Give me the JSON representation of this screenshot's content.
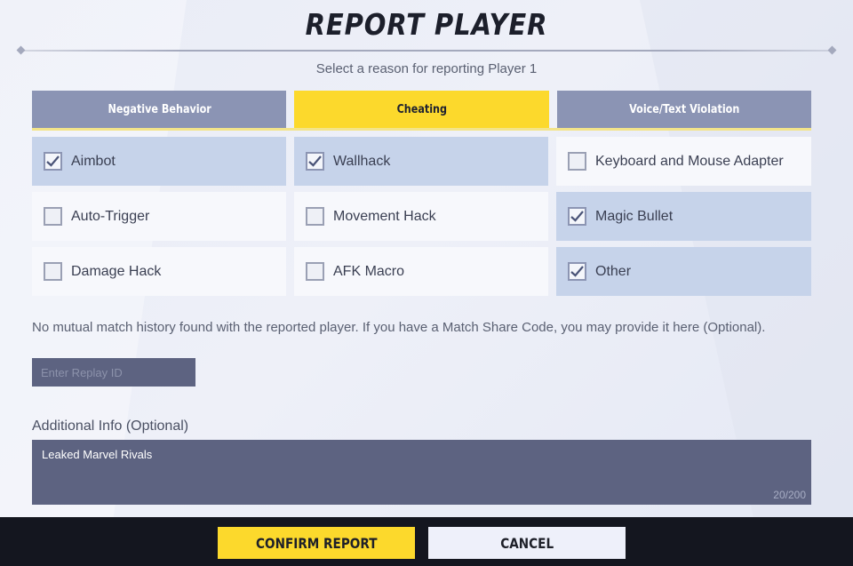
{
  "dialog": {
    "title": "REPORT PLAYER",
    "subtitle": "Select a reason for reporting Player 1"
  },
  "tabs": [
    {
      "label": "Negative Behavior",
      "active": false
    },
    {
      "label": "Cheating",
      "active": true
    },
    {
      "label": "Voice/Text Violation",
      "active": false
    }
  ],
  "options": [
    {
      "label": "Aimbot",
      "checked": true
    },
    {
      "label": "Wallhack",
      "checked": true
    },
    {
      "label": "Keyboard and Mouse Adapter",
      "checked": false
    },
    {
      "label": "Auto-Trigger",
      "checked": false
    },
    {
      "label": "Movement Hack",
      "checked": false
    },
    {
      "label": "Magic Bullet",
      "checked": true
    },
    {
      "label": "Damage Hack",
      "checked": false
    },
    {
      "label": "AFK Macro",
      "checked": false
    },
    {
      "label": "Other",
      "checked": true
    }
  ],
  "match": {
    "notice": "No mutual match history found with the reported player. If you have a Match Share Code, you may provide it here (Optional).",
    "replay_placeholder": "Enter Replay ID",
    "replay_value": ""
  },
  "additional_info": {
    "label": "Additional Info (Optional)",
    "value": "Leaked Marvel Rivals",
    "char_count": "20/200"
  },
  "footer": {
    "confirm_label": "CONFIRM REPORT",
    "cancel_label": "CANCEL"
  },
  "colors": {
    "accent": "#fcd92c",
    "tab_inactive": "#8b94b4",
    "option_checked": "#c6d3ea",
    "input_bg": "#5d6381"
  },
  "icons": {
    "checkbox": "checkmark-icon"
  }
}
